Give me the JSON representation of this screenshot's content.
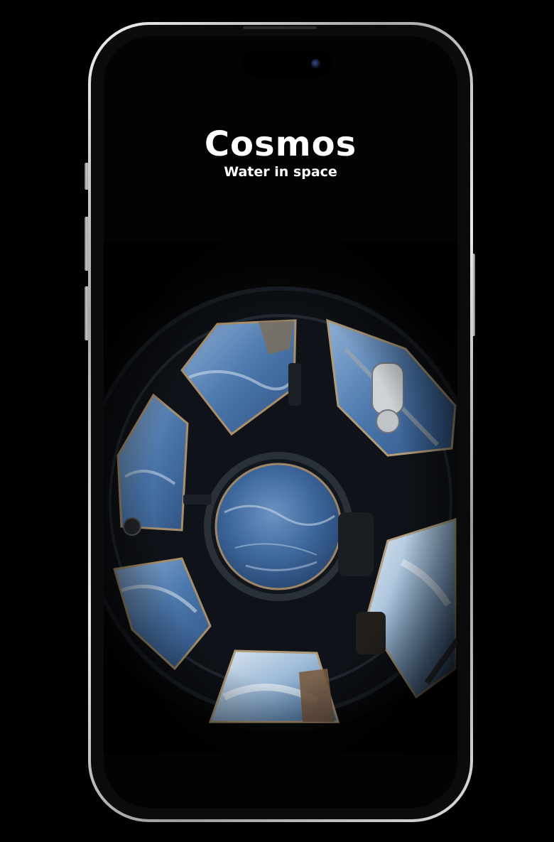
{
  "app": {
    "title": "Cosmos",
    "subtitle": "Water in space"
  },
  "scene": {
    "image_subject": "cupola-window-view",
    "icon": "cupola-window-image"
  },
  "colors": {
    "background": "#000000",
    "screen": "#030303",
    "text": "#ffffff",
    "earth_blue": "#3f6fa8",
    "frame": "#0e1116"
  }
}
